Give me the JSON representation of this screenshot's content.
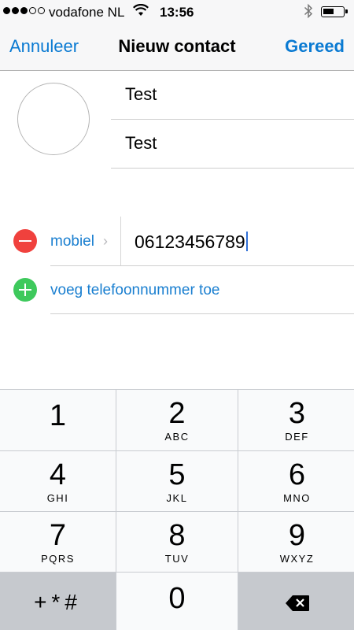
{
  "status_bar": {
    "carrier": "vodafone NL",
    "time": "13:56",
    "signal_dots": [
      "on",
      "on",
      "on",
      "off",
      "off"
    ],
    "icons": [
      "wifi-icon",
      "bluetooth-icon",
      "battery-icon"
    ]
  },
  "nav": {
    "cancel_label": "Annuleer",
    "title": "Nieuw contact",
    "done_label": "Gereed"
  },
  "form": {
    "first_name": "Test",
    "last_name": "Test",
    "phone": {
      "label": "mobiel",
      "value": "06123456789"
    },
    "add_phone_label": "voeg telefoonnummer toe"
  },
  "keypad": {
    "keys": [
      {
        "digit": "1",
        "letters": ""
      },
      {
        "digit": "2",
        "letters": "ABC"
      },
      {
        "digit": "3",
        "letters": "DEF"
      },
      {
        "digit": "4",
        "letters": "GHI"
      },
      {
        "digit": "5",
        "letters": "JKL"
      },
      {
        "digit": "6",
        "letters": "MNO"
      },
      {
        "digit": "7",
        "letters": "PQRS"
      },
      {
        "digit": "8",
        "letters": "TUV"
      },
      {
        "digit": "9",
        "letters": "WXYZ"
      }
    ],
    "symbols_label": "+*#",
    "zero": "0"
  },
  "colors": {
    "accent": "#0a7ad2",
    "remove": "#f0413d",
    "add": "#3ec95c"
  }
}
